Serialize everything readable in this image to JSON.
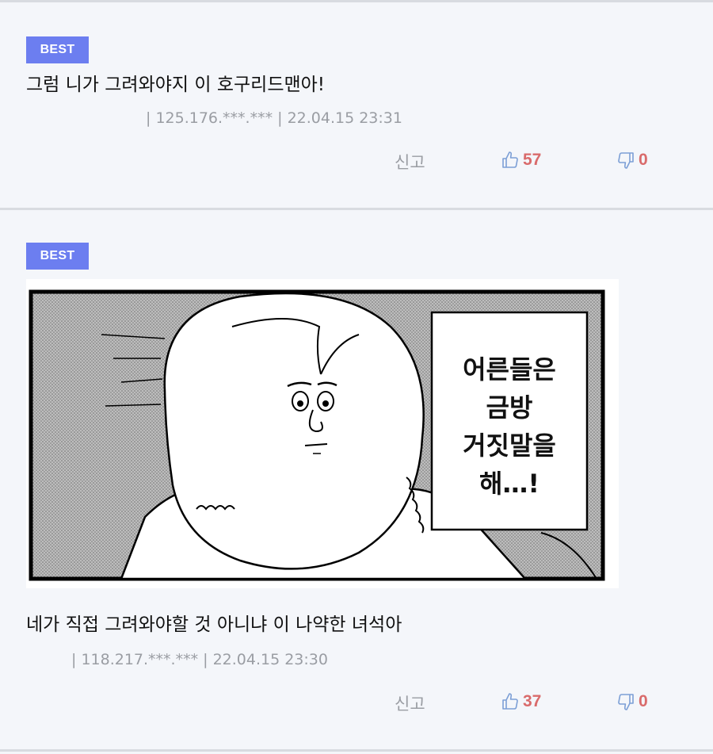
{
  "comments": [
    {
      "badge": "BEST",
      "text": "그럼 니가 그려와야지 이 호구리드맨아!",
      "meta": "| 125.176.***.*** | 22.04.15 23:31",
      "report_label": "신고",
      "likes": "57",
      "dislikes": "0"
    },
    {
      "badge": "BEST",
      "image": {
        "speech_text_lines": [
          "어른들은",
          "금방",
          "거짓말을",
          "해…!"
        ]
      },
      "text": "네가 직접 그려와야할 것 아니냐 이 나약한 녀석아",
      "meta": "| 118.217.***.*** | 22.04.15 23:30",
      "report_label": "신고",
      "likes": "37",
      "dislikes": "0"
    }
  ],
  "colors": {
    "badge_bg": "#6c7ef0",
    "like_icon": "#7c9fd6",
    "count": "#d96b6b",
    "meta": "#9a9da3"
  }
}
